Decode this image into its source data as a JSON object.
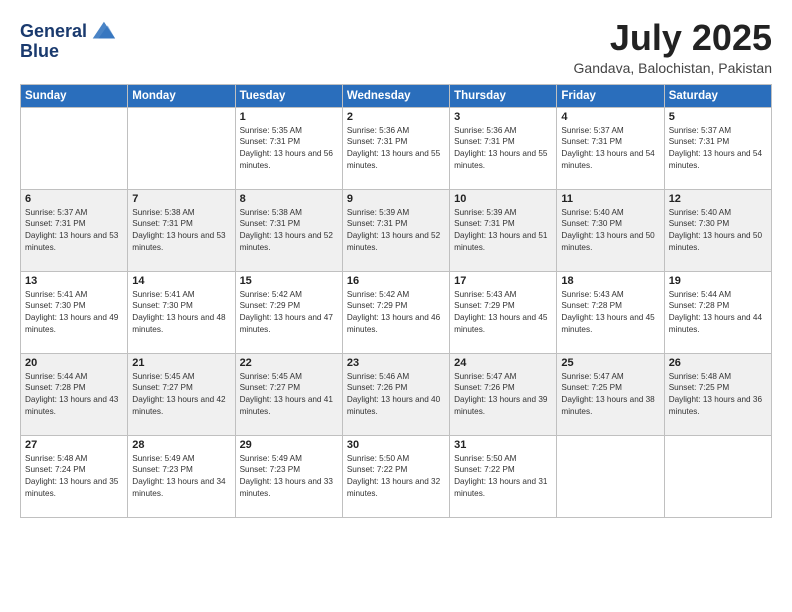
{
  "logo": {
    "line1": "General",
    "line2": "Blue"
  },
  "title": "July 2025",
  "subtitle": "Gandava, Balochistan, Pakistan",
  "weekdays": [
    "Sunday",
    "Monday",
    "Tuesday",
    "Wednesday",
    "Thursday",
    "Friday",
    "Saturday"
  ],
  "weeks": [
    [
      {
        "day": "",
        "sunrise": "",
        "sunset": "",
        "daylight": ""
      },
      {
        "day": "",
        "sunrise": "",
        "sunset": "",
        "daylight": ""
      },
      {
        "day": "1",
        "sunrise": "Sunrise: 5:35 AM",
        "sunset": "Sunset: 7:31 PM",
        "daylight": "Daylight: 13 hours and 56 minutes."
      },
      {
        "day": "2",
        "sunrise": "Sunrise: 5:36 AM",
        "sunset": "Sunset: 7:31 PM",
        "daylight": "Daylight: 13 hours and 55 minutes."
      },
      {
        "day": "3",
        "sunrise": "Sunrise: 5:36 AM",
        "sunset": "Sunset: 7:31 PM",
        "daylight": "Daylight: 13 hours and 55 minutes."
      },
      {
        "day": "4",
        "sunrise": "Sunrise: 5:37 AM",
        "sunset": "Sunset: 7:31 PM",
        "daylight": "Daylight: 13 hours and 54 minutes."
      },
      {
        "day": "5",
        "sunrise": "Sunrise: 5:37 AM",
        "sunset": "Sunset: 7:31 PM",
        "daylight": "Daylight: 13 hours and 54 minutes."
      }
    ],
    [
      {
        "day": "6",
        "sunrise": "Sunrise: 5:37 AM",
        "sunset": "Sunset: 7:31 PM",
        "daylight": "Daylight: 13 hours and 53 minutes."
      },
      {
        "day": "7",
        "sunrise": "Sunrise: 5:38 AM",
        "sunset": "Sunset: 7:31 PM",
        "daylight": "Daylight: 13 hours and 53 minutes."
      },
      {
        "day": "8",
        "sunrise": "Sunrise: 5:38 AM",
        "sunset": "Sunset: 7:31 PM",
        "daylight": "Daylight: 13 hours and 52 minutes."
      },
      {
        "day": "9",
        "sunrise": "Sunrise: 5:39 AM",
        "sunset": "Sunset: 7:31 PM",
        "daylight": "Daylight: 13 hours and 52 minutes."
      },
      {
        "day": "10",
        "sunrise": "Sunrise: 5:39 AM",
        "sunset": "Sunset: 7:31 PM",
        "daylight": "Daylight: 13 hours and 51 minutes."
      },
      {
        "day": "11",
        "sunrise": "Sunrise: 5:40 AM",
        "sunset": "Sunset: 7:30 PM",
        "daylight": "Daylight: 13 hours and 50 minutes."
      },
      {
        "day": "12",
        "sunrise": "Sunrise: 5:40 AM",
        "sunset": "Sunset: 7:30 PM",
        "daylight": "Daylight: 13 hours and 50 minutes."
      }
    ],
    [
      {
        "day": "13",
        "sunrise": "Sunrise: 5:41 AM",
        "sunset": "Sunset: 7:30 PM",
        "daylight": "Daylight: 13 hours and 49 minutes."
      },
      {
        "day": "14",
        "sunrise": "Sunrise: 5:41 AM",
        "sunset": "Sunset: 7:30 PM",
        "daylight": "Daylight: 13 hours and 48 minutes."
      },
      {
        "day": "15",
        "sunrise": "Sunrise: 5:42 AM",
        "sunset": "Sunset: 7:29 PM",
        "daylight": "Daylight: 13 hours and 47 minutes."
      },
      {
        "day": "16",
        "sunrise": "Sunrise: 5:42 AM",
        "sunset": "Sunset: 7:29 PM",
        "daylight": "Daylight: 13 hours and 46 minutes."
      },
      {
        "day": "17",
        "sunrise": "Sunrise: 5:43 AM",
        "sunset": "Sunset: 7:29 PM",
        "daylight": "Daylight: 13 hours and 45 minutes."
      },
      {
        "day": "18",
        "sunrise": "Sunrise: 5:43 AM",
        "sunset": "Sunset: 7:28 PM",
        "daylight": "Daylight: 13 hours and 45 minutes."
      },
      {
        "day": "19",
        "sunrise": "Sunrise: 5:44 AM",
        "sunset": "Sunset: 7:28 PM",
        "daylight": "Daylight: 13 hours and 44 minutes."
      }
    ],
    [
      {
        "day": "20",
        "sunrise": "Sunrise: 5:44 AM",
        "sunset": "Sunset: 7:28 PM",
        "daylight": "Daylight: 13 hours and 43 minutes."
      },
      {
        "day": "21",
        "sunrise": "Sunrise: 5:45 AM",
        "sunset": "Sunset: 7:27 PM",
        "daylight": "Daylight: 13 hours and 42 minutes."
      },
      {
        "day": "22",
        "sunrise": "Sunrise: 5:45 AM",
        "sunset": "Sunset: 7:27 PM",
        "daylight": "Daylight: 13 hours and 41 minutes."
      },
      {
        "day": "23",
        "sunrise": "Sunrise: 5:46 AM",
        "sunset": "Sunset: 7:26 PM",
        "daylight": "Daylight: 13 hours and 40 minutes."
      },
      {
        "day": "24",
        "sunrise": "Sunrise: 5:47 AM",
        "sunset": "Sunset: 7:26 PM",
        "daylight": "Daylight: 13 hours and 39 minutes."
      },
      {
        "day": "25",
        "sunrise": "Sunrise: 5:47 AM",
        "sunset": "Sunset: 7:25 PM",
        "daylight": "Daylight: 13 hours and 38 minutes."
      },
      {
        "day": "26",
        "sunrise": "Sunrise: 5:48 AM",
        "sunset": "Sunset: 7:25 PM",
        "daylight": "Daylight: 13 hours and 36 minutes."
      }
    ],
    [
      {
        "day": "27",
        "sunrise": "Sunrise: 5:48 AM",
        "sunset": "Sunset: 7:24 PM",
        "daylight": "Daylight: 13 hours and 35 minutes."
      },
      {
        "day": "28",
        "sunrise": "Sunrise: 5:49 AM",
        "sunset": "Sunset: 7:23 PM",
        "daylight": "Daylight: 13 hours and 34 minutes."
      },
      {
        "day": "29",
        "sunrise": "Sunrise: 5:49 AM",
        "sunset": "Sunset: 7:23 PM",
        "daylight": "Daylight: 13 hours and 33 minutes."
      },
      {
        "day": "30",
        "sunrise": "Sunrise: 5:50 AM",
        "sunset": "Sunset: 7:22 PM",
        "daylight": "Daylight: 13 hours and 32 minutes."
      },
      {
        "day": "31",
        "sunrise": "Sunrise: 5:50 AM",
        "sunset": "Sunset: 7:22 PM",
        "daylight": "Daylight: 13 hours and 31 minutes."
      },
      {
        "day": "",
        "sunrise": "",
        "sunset": "",
        "daylight": ""
      },
      {
        "day": "",
        "sunrise": "",
        "sunset": "",
        "daylight": ""
      }
    ]
  ]
}
